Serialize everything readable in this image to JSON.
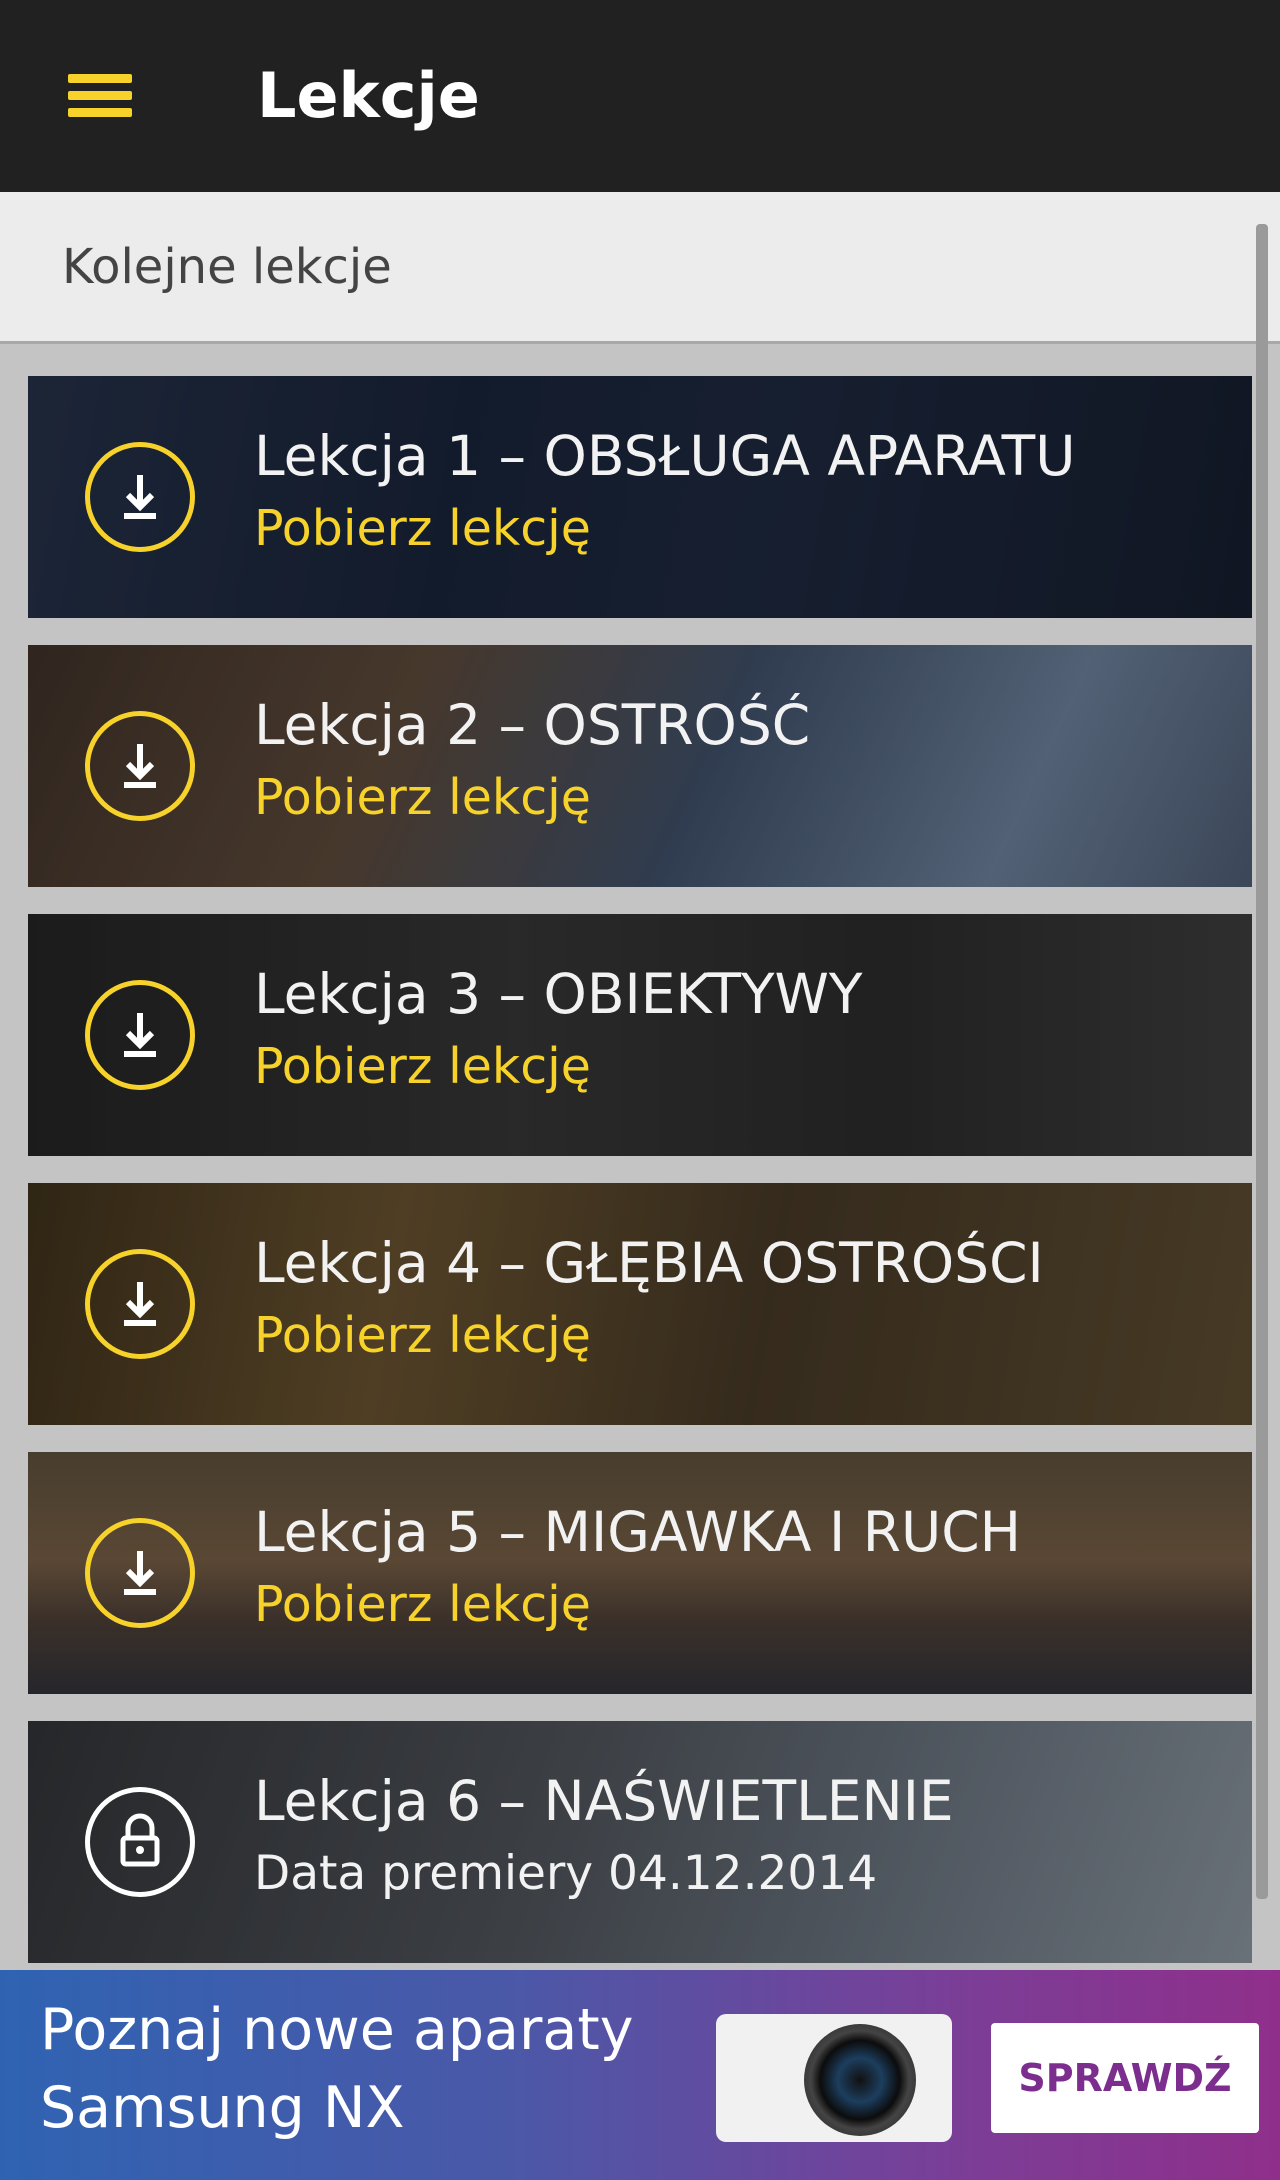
{
  "app_bar": {
    "title": "Lekcje",
    "menu_icon": "hamburger-menu-icon"
  },
  "section": {
    "label": "Kolejne lekcje"
  },
  "lessons": [
    {
      "title": "Lekcja 1 – OBSŁUGA APARATU",
      "subtitle": "Pobierz lekcję",
      "icon": "download-icon",
      "locked": false
    },
    {
      "title": "Lekcja 2 – OSTROŚĆ",
      "subtitle": "Pobierz lekcję",
      "icon": "download-icon",
      "locked": false
    },
    {
      "title": "Lekcja 3 – OBIEKTYWY",
      "subtitle": "Pobierz lekcję",
      "icon": "download-icon",
      "locked": false
    },
    {
      "title": "Lekcja 4 – GŁĘBIA OSTROŚCI",
      "subtitle": "Pobierz lekcję",
      "icon": "download-icon",
      "locked": false
    },
    {
      "title": "Lekcja 5 – MIGAWKA I RUCH",
      "subtitle": "Pobierz lekcję",
      "icon": "download-icon",
      "locked": false
    },
    {
      "title": "Lekcja 6 – NAŚWIETLENIE",
      "subtitle": "Data premiery 04.12.2014",
      "icon": "lock-icon",
      "locked": true
    }
  ],
  "ad": {
    "line1": "Poznaj nowe aparaty",
    "line2": "Samsung NX",
    "button_label": "SPRAWDŹ",
    "image": "camera-image"
  },
  "colors": {
    "accent": "#f7d22a",
    "app_bar": "#212121"
  }
}
